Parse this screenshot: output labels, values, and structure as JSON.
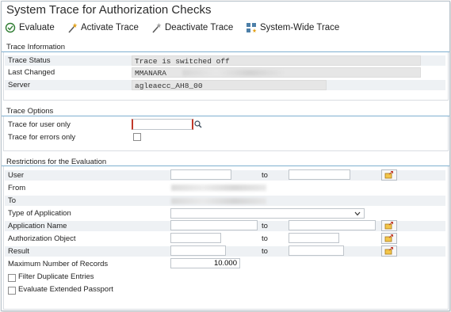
{
  "window": {
    "title": "System Trace for Authorization Checks"
  },
  "toolbar": {
    "evaluate_label": "Evaluate",
    "activate_label": "Activate Trace",
    "deactivate_label": "Deactivate Trace",
    "systemwide_label": "System-Wide Trace"
  },
  "trace_info": {
    "heading": "Trace Information",
    "status_label": "Trace Status",
    "status_value": "Trace is switched off",
    "last_changed_label": "Last Changed",
    "last_changed_user": "MMANARA",
    "server_label": "Server",
    "server_value": "agleaecc_AH8_00"
  },
  "trace_options": {
    "heading": "Trace Options",
    "user_only_label": "Trace for user only",
    "user_only_value": "",
    "errors_only_label": "Trace for errors only",
    "errors_only_checked": false
  },
  "restrictions": {
    "heading": "Restrictions for the Evaluation",
    "to_label": "to",
    "user_label": "User",
    "from_label": "From",
    "to_date_label": "To",
    "type_label": "Type of Application",
    "app_name_label": "Application Name",
    "auth_obj_label": "Authorization Object",
    "result_label": "Result",
    "max_records_label": "Maximum Number of Records",
    "max_records_value": "10.000",
    "filter_dup_label": "Filter Duplicate Entries",
    "filter_dup_checked": false,
    "extended_pp_label": "Evaluate Extended Passport",
    "extended_pp_checked": false
  },
  "icons": [
    "evaluate-icon",
    "activate-trace-icon",
    "deactivate-trace-icon",
    "system-wide-trace-icon",
    "search-help-icon",
    "multiple-selection-icon",
    "dropdown-chevron-icon"
  ]
}
